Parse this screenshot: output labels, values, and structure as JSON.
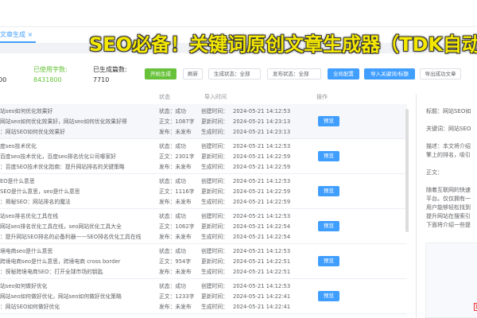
{
  "tab": {
    "label": "文章生成",
    "close": "×"
  },
  "headline": "SEO必备！关键词原创文章生成器（TDK自动",
  "stats": [
    {
      "label": "",
      "value": "00"
    },
    {
      "label": "已使用字数:",
      "value": "8431800"
    },
    {
      "label": "已生成篇数:",
      "value": "7710"
    }
  ],
  "toolbar": {
    "start": "开始生成",
    "refresh": "刷新",
    "gen_status": "生成状态：全部",
    "pub_status": "发布状态：全部",
    "global_config": "全局配置",
    "import": "导入关键词/标题",
    "export": "导出成功文章"
  },
  "headers": {
    "status": "状态",
    "import_time": "导入时间",
    "action": "操作"
  },
  "rows": [
    {
      "t1": "站seo如何优化效果好",
      "t2": "网站seo如何优化效果好，网站seo如何优化效果好得",
      "t3": "：网站SEO如何优化效果好",
      "status": "状态：成功",
      "words": "正文：1087字",
      "publish": "发布：未发布",
      "created": "创建时间：",
      "created_v": "2024-05-21 14:12:53",
      "updated": "更新时间：",
      "updated_v": "2024-05-21 14:23:13",
      "gen": "生成时间：",
      "gen_v": "2024-05-21 14:23:13",
      "btn": "预览"
    },
    {
      "t1": "度seo技术优化",
      "t2": "百度seo技术优化，百度seo排名优化公司哪家好",
      "t3": "：百度SEO技术优化指南：提升网站排名的关键策略",
      "status": "状态：成功",
      "words": "正文：2301字",
      "publish": "发布：未发布",
      "created": "创建时间：",
      "created_v": "2024-05-21 14:12:53",
      "updated": "更新时间：",
      "updated_v": "2024-05-21 14:22:59",
      "gen": "生成时间：",
      "gen_v": "2024-05-21 14:22:59",
      "btn": "预览"
    },
    {
      "t1": "EO是什么意思",
      "t2": "SEO是什么意思，seo是什么意思",
      "t3": "：揭秘SEO：网站排名的魔法",
      "status": "状态：成功",
      "words": "正文：1116字",
      "publish": "发布：未发布",
      "created": "创建时间：",
      "created_v": "2024-05-21 14:12:53",
      "updated": "更新时间：",
      "updated_v": "2024-05-21 14:22:59",
      "gen": "生成时间：",
      "gen_v": "2024-05-21 14:22:59",
      "btn": "预览"
    },
    {
      "t1": "站seo排名优化工具在线",
      "t2": "网站seo排名优化工具在线，seo网站优化工具大全",
      "t3": "：提升网站SEO排名的必备利器——SEO排名优化工具在线",
      "status": "状态：成功",
      "words": "正文：1062字",
      "publish": "发布：未发布",
      "created": "创建时间：",
      "created_v": "2024-05-21 14:12:53",
      "updated": "更新时间：",
      "updated_v": "2024-05-21 14:22:54",
      "gen": "生成时间：",
      "gen_v": "2024-05-21 14:22:54",
      "btn": "预览"
    },
    {
      "t1": "境电商seo是什么意思",
      "t2": "跨境电商seo是什么意思，跨境电商 cross border",
      "t3": "：探秘跨境电商SEO：打开全球市场的钥匙",
      "status": "状态：成功",
      "words": "正文：954字",
      "publish": "发布：未发布",
      "created": "创建时间：",
      "created_v": "2024-05-21 14:12:53",
      "updated": "更新时间：",
      "updated_v": "2024-05-21 14:22:51",
      "gen": "生成时间：",
      "gen_v": "2024-05-21 14:22:51",
      "btn": "预览"
    },
    {
      "t1": "站seo如何做好优化",
      "t2": "网站seo如何做好优化，网站seo如何做好优化策略",
      "t3": "：网站SEO如何做好优化",
      "status": "状态：成功",
      "words": "正文：1233字",
      "publish": "发布：未发布",
      "created": "创建时间：",
      "created_v": "2024-05-21 14:12:53",
      "updated": "更新时间：",
      "updated_v": "2024-05-21 14:22:41",
      "gen": "生成时间：",
      "gen_v": "2024-05-21 14:22:41",
      "btn": "预览"
    }
  ],
  "preview": {
    "title": "标题：网站SEO如",
    "keywords": "关键词：网站SEO",
    "desc1": "描述：本文将介绍",
    "desc2": "擎上的排名，吸引",
    "body_label": "正文：",
    "p1": "随着互联网的快速",
    "p2": "平台。仅仅拥有一",
    "p3": "用户能够轻松找到",
    "p4": "提升网站在搜索引",
    "p5": "下面将介绍一些提",
    "thumb_badge": "14"
  }
}
